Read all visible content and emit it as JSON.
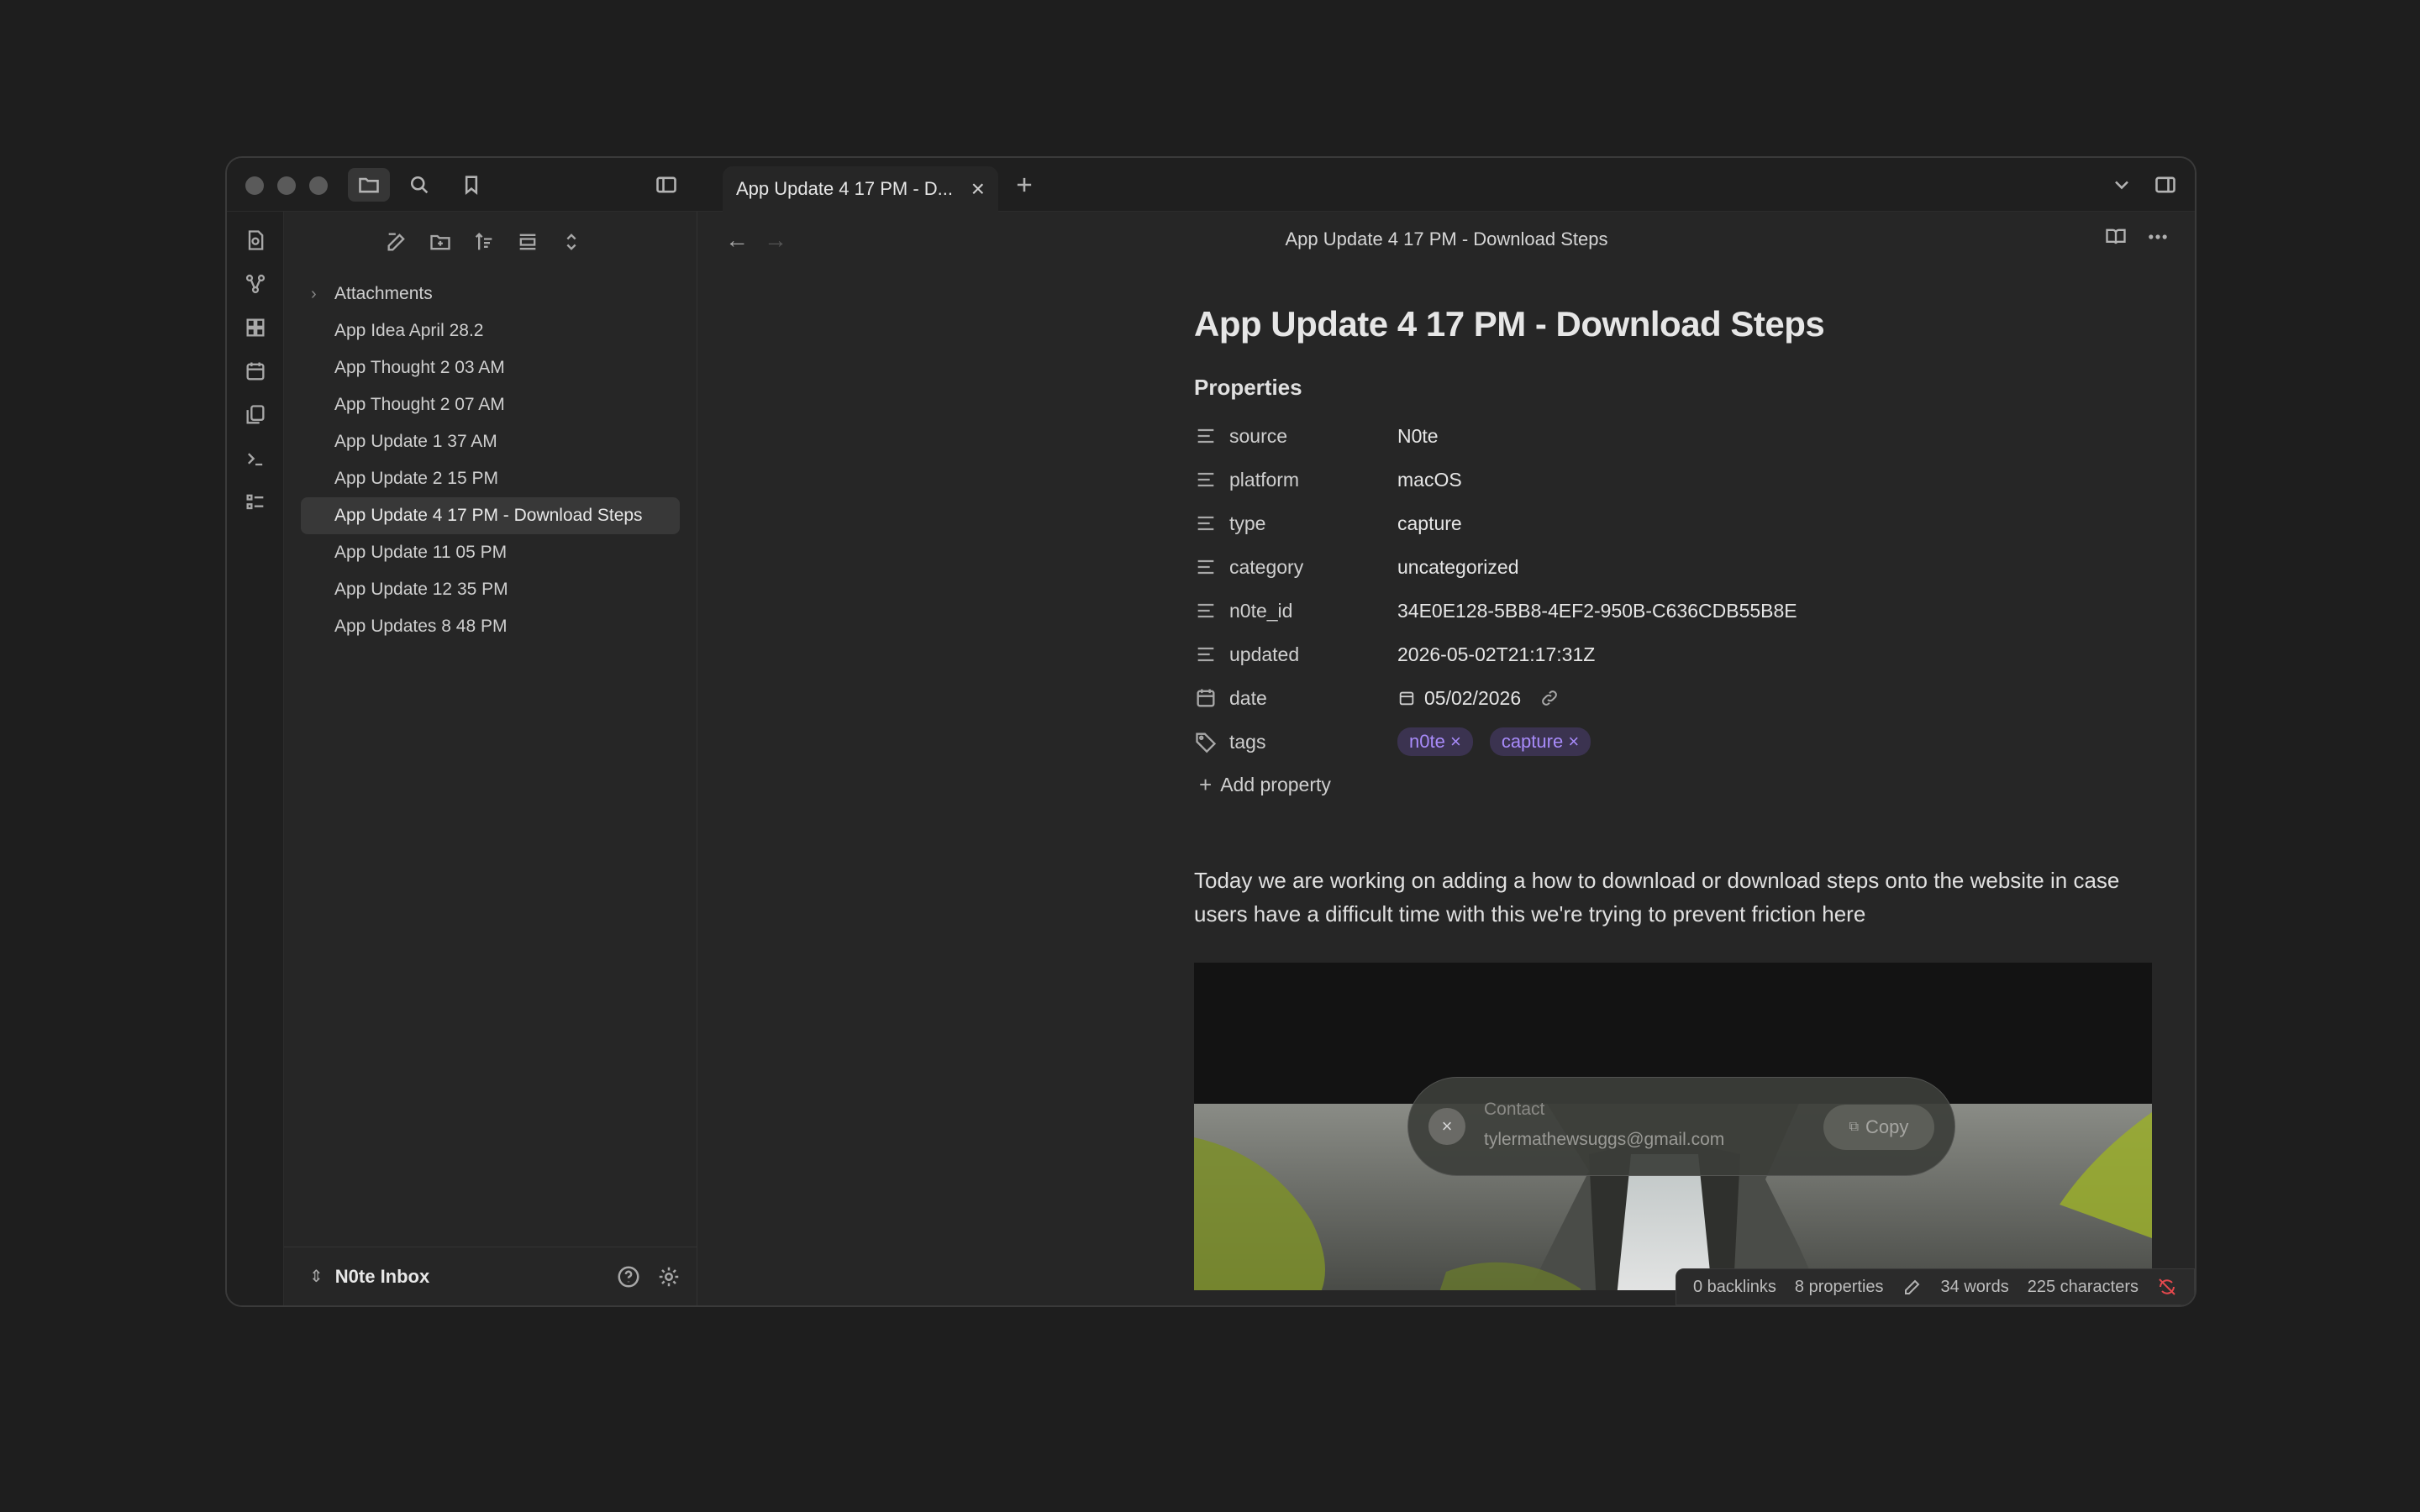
{
  "tab": {
    "title": "App Update 4 17 PM - D..."
  },
  "sidebar": {
    "folder": "Attachments",
    "files": [
      "App Idea April 28.2",
      "App Thought 2 03 AM",
      "App Thought 2 07 AM",
      "App Update 1 37 AM",
      "App Update 2 15 PM",
      "App Update 4 17 PM - Download Steps",
      "App Update 11 05 PM",
      "App Update 12 35 PM",
      "App Updates 8 48 PM"
    ],
    "active_index": 5,
    "vault": "N0te Inbox"
  },
  "view": {
    "title": "App Update 4 17 PM - Download Steps"
  },
  "note": {
    "title": "App Update 4 17 PM - Download Steps",
    "properties_heading": "Properties",
    "properties": [
      {
        "key": "source",
        "value": "N0te",
        "icon": "text-lines-icon"
      },
      {
        "key": "platform",
        "value": "macOS",
        "icon": "text-lines-icon"
      },
      {
        "key": "type",
        "value": "capture",
        "icon": "text-lines-icon"
      },
      {
        "key": "category",
        "value": "uncategorized",
        "icon": "text-lines-icon"
      },
      {
        "key": "n0te_id",
        "value": "34E0E128-5BB8-4EF2-950B-C636CDB55B8E",
        "icon": "text-lines-icon"
      },
      {
        "key": "updated",
        "value": "2026-05-02T21:17:31Z",
        "icon": "text-lines-icon"
      },
      {
        "key": "date",
        "value": "05/02/2026",
        "icon": "calendar-icon"
      },
      {
        "key": "tags",
        "value": "",
        "icon": "tag-icon"
      }
    ],
    "tags": [
      "n0te",
      "capture"
    ],
    "add_property": "Add property",
    "body": "Today we are working on adding a how to download or download steps onto the website in case users have a difficult time with this we're trying to prevent friction here"
  },
  "contact_popup": {
    "label": "Contact",
    "value": "tylermathewsuggs@gmail.com",
    "copy": "Copy"
  },
  "status": {
    "backlinks": "0 backlinks",
    "properties": "8 properties",
    "words": "34 words",
    "characters": "225 characters"
  },
  "colors": {
    "tag_bg": "#3b3350",
    "tag_text": "#a88bfa",
    "sync_error": "#e5484d"
  }
}
